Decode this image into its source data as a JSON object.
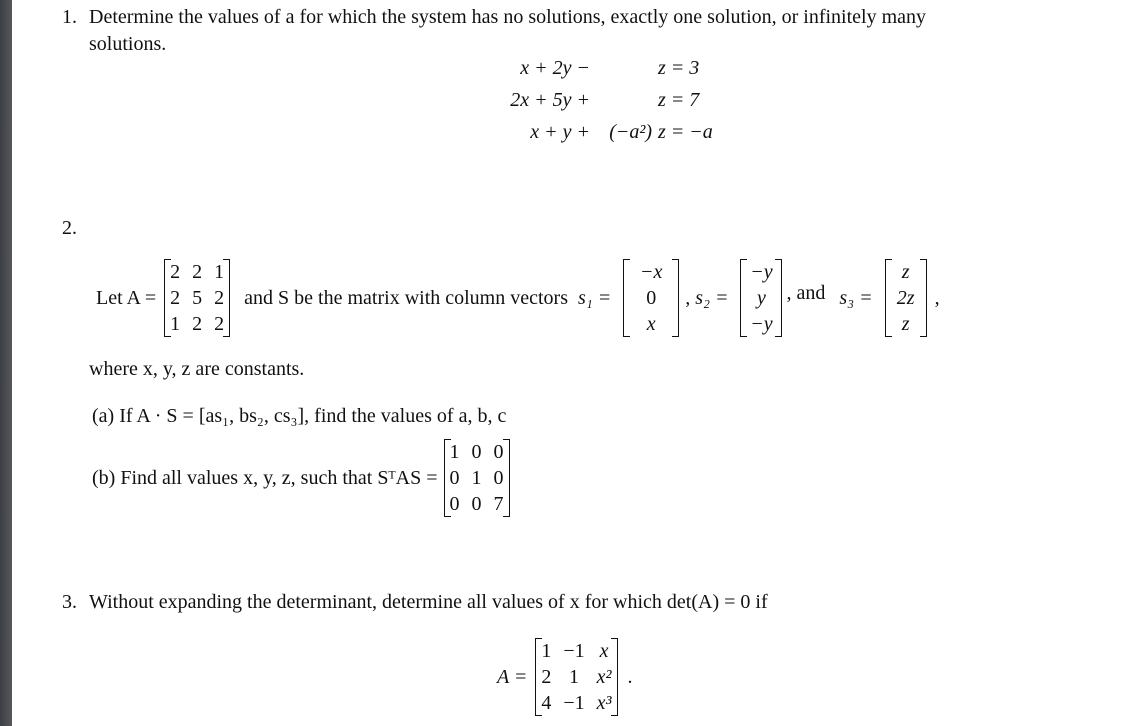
{
  "problem1": {
    "number": "1.",
    "text_line1": "Determine the values of a for which the system has no solutions, exactly one solution, or infinitely many",
    "text_line2": "solutions.",
    "equations": [
      {
        "lhs": "x + 2y −",
        "coef": "",
        "rhs": "z = 3"
      },
      {
        "lhs": "2x + 5y +",
        "coef": "",
        "rhs": "z = 7"
      },
      {
        "lhs": "x +  y +",
        "coef": "(−a²)",
        "rhs": "z = −a"
      }
    ]
  },
  "problem2": {
    "number": "2.",
    "let_label": "Let A =",
    "matrix_A": [
      [
        "2",
        "2",
        "1"
      ],
      [
        "2",
        "5",
        "2"
      ],
      [
        "1",
        "2",
        "2"
      ]
    ],
    "mid_text": "and S be the matrix with column vectors",
    "s1_label": "s₁ =",
    "s1": [
      "−x",
      "0",
      "x"
    ],
    "s2_label": ", s₂ =",
    "s2": [
      "−y",
      "y",
      "−y"
    ],
    "and_label": ", and",
    "s3_label": "s₃ =",
    "s3": [
      "z",
      "2z",
      "z"
    ],
    "trailing": ",",
    "where_text": "where x, y, z are constants.",
    "part_a": "(a) If  A · S = [as₁, bs₂, cs₃], find the values of a, b, c",
    "part_b": "(b) Find all values  x, y, z,  such that SᵀAS =",
    "matrix_b": [
      [
        "1",
        "0",
        "0"
      ],
      [
        "0",
        "1",
        "0"
      ],
      [
        "0",
        "0",
        "7"
      ]
    ]
  },
  "problem3": {
    "number": "3.",
    "text": "Without expanding the determinant, determine all values of x for which det(A) = 0 if",
    "a_label": "A =",
    "matrix": [
      [
        "1",
        "−1",
        "x"
      ],
      [
        "2",
        "1",
        "x²"
      ],
      [
        "4",
        "−1",
        "x³"
      ]
    ],
    "trailing": "."
  }
}
